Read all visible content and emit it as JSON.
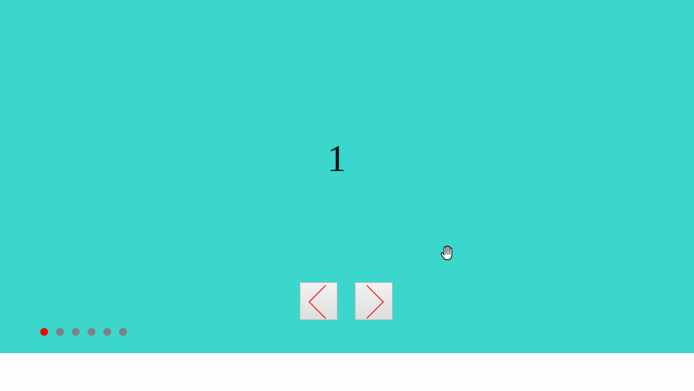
{
  "carousel": {
    "current_slide": "1",
    "background_color": "#3bd6cc",
    "prev_icon": "chevron-left-icon",
    "next_icon": "chevron-right-icon",
    "arrow_color": "#ff0000",
    "dots": [
      {
        "active": true
      },
      {
        "active": false
      },
      {
        "active": false
      },
      {
        "active": false
      },
      {
        "active": false
      },
      {
        "active": false
      }
    ],
    "active_dot_color": "#ff0000",
    "inactive_dot_color": "#808080"
  },
  "cursor": {
    "icon": "hand-cursor-icon"
  }
}
